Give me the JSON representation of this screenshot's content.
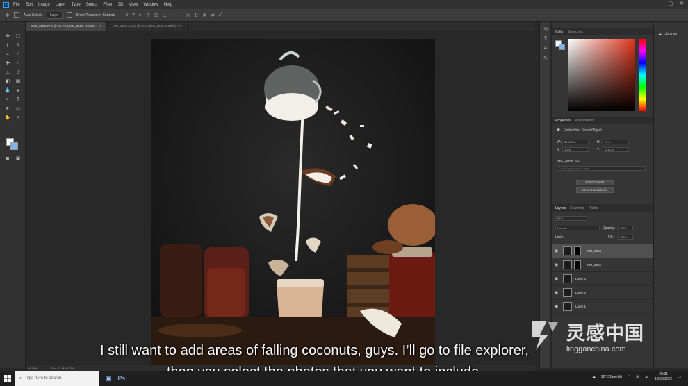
{
  "app": {
    "icon_label": "Ps",
    "menu": [
      "File",
      "Edit",
      "Image",
      "Layer",
      "Type",
      "Select",
      "Filter",
      "3D",
      "View",
      "Window",
      "Help"
    ]
  },
  "options_bar": {
    "auto_select_label": "Auto-Select:",
    "auto_select_value": "Layer",
    "show_transform_label": "Show Transform Controls"
  },
  "tabs": [
    {
      "label": "IMG_8056.JPG @ 25.7% (IMG_8058, RGB/8) *",
      "active": true
    },
    {
      "label": "IMG_8054-4.psd @ 16% (IMG_8055, RGB/8) *",
      "active": false
    }
  ],
  "status": {
    "zoom": "16.79%",
    "doc": "Doc: 53.4M/95.3M"
  },
  "color_panel": {
    "tabs": [
      "Color",
      "Swatches"
    ],
    "accent": "#e0341a"
  },
  "properties_panel": {
    "tabs": [
      "Properties",
      "Adjustments"
    ],
    "type_label": "Embedded Smart Object",
    "w_label": "W:",
    "w_value": "30.467 in",
    "h_label": "H:",
    "h_value": "70 in",
    "x_label": "X:",
    "x_value": "1.3 in",
    "y_label": "Y:",
    "y_value": "-5.52 in",
    "file_name": "IMG_8058.JPG",
    "comp_placeholder": "Don't Apply Layer Comp",
    "edit_contents": "Edit Contents",
    "convert_linked": "Convert to Linked..."
  },
  "layers_panel": {
    "tabs": [
      "Layers",
      "Channels",
      "Paths"
    ],
    "filter_kind": "Kind",
    "blend_mode": "Normal",
    "opacity_label": "Opacity:",
    "opacity_value": "100%",
    "lock_label": "Lock:",
    "fill_label": "Fill:",
    "fill_value": "100%",
    "layers": [
      {
        "name": "IMG_8058",
        "active": true
      },
      {
        "name": "IMG_8055",
        "active": false
      },
      {
        "name": "Layer 3",
        "active": false
      },
      {
        "name": "Layer 2",
        "active": false
      },
      {
        "name": "Layer 1",
        "active": false
      }
    ]
  },
  "libraries": {
    "label": "Libraries"
  },
  "taskbar": {
    "search_placeholder": "Type here to search",
    "weather": "28°C Bewölkt",
    "time": "08:31",
    "date": "14/03/2022"
  },
  "subtitles": {
    "line1": "I still want to add areas of falling coconuts, guys. I’ll go to file explorer,",
    "line2": "then you select the photos that you want to include"
  },
  "watermark": {
    "text": "灵感中国",
    "url": "lingganchina.com"
  }
}
